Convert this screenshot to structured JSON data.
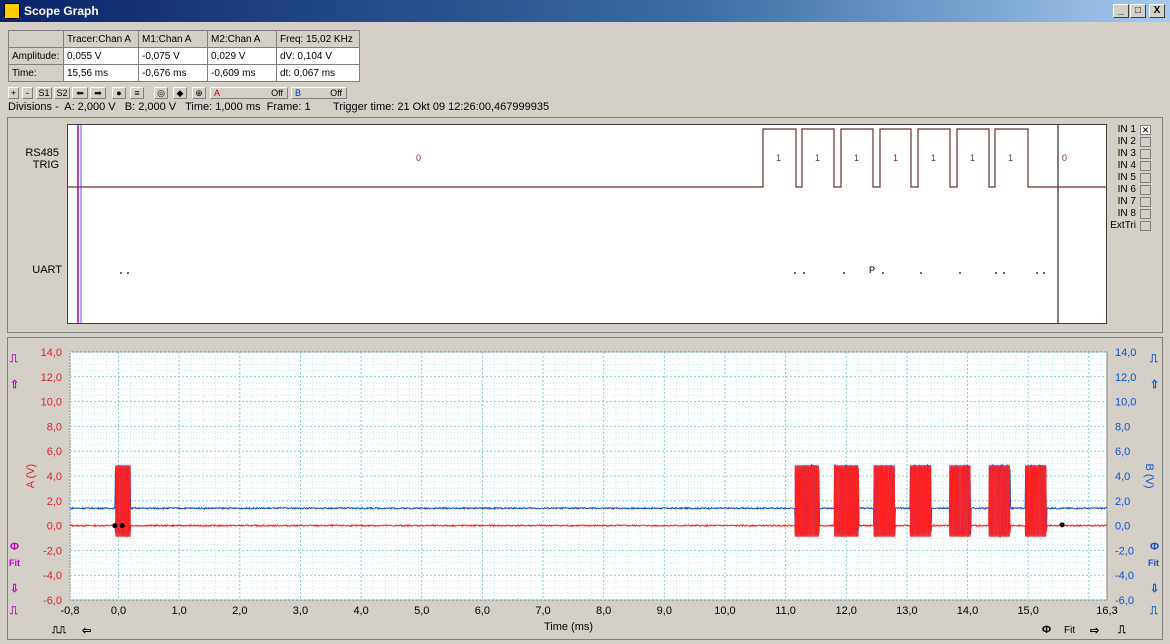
{
  "window": {
    "title": "Scope Graph",
    "buttons": [
      "_",
      "□",
      "X"
    ]
  },
  "measurements": {
    "headers": [
      "",
      "Tracer:Chan A",
      "M1:Chan A",
      "M2:Chan A",
      "Freq: 15,02 KHz"
    ],
    "rows": [
      [
        "Amplitude:",
        "0,055 V",
        "-0,075 V",
        "0,029 V",
        "dV: 0,104 V"
      ],
      [
        "Time:",
        "15,56 ms",
        "-0,676 ms",
        "-0,609 ms",
        "dt: 0,067 ms"
      ]
    ]
  },
  "toolbar": {
    "buttons": [
      "+",
      "-",
      "S1",
      "S2",
      "⬅",
      "➡",
      "●",
      "≡",
      "◎",
      "◆",
      "⊕"
    ],
    "chanA_label": "A",
    "chanA_state": "Off",
    "chanB_label": "B",
    "chanB_state": "Off"
  },
  "info": {
    "divisions": "Divisions -  A: 2,000 V   B: 2,000 V   Time: 1,000 ms  Frame: 1",
    "trigger": "Trigger time: 21 Okt 09 12:26:00,467999935"
  },
  "logic": {
    "rows": [
      {
        "label": "RS485"
      },
      {
        "label": "TRIG"
      },
      {
        "label": "UART"
      }
    ],
    "bits": [
      "0",
      "1",
      "1",
      "1",
      "1",
      "1",
      "1",
      "1",
      "0"
    ],
    "uart_char": "P",
    "inputs": [
      "IN 1",
      "IN 2",
      "IN 3",
      "IN 4",
      "IN 5",
      "IN 6",
      "IN 7",
      "IN 8",
      "ExtTri"
    ],
    "checked_input": "IN 1"
  },
  "chart_data": {
    "type": "line",
    "xlabel": "Time (ms)",
    "ylabel_left": "A (V)",
    "ylabel_right": "B (V)",
    "xlim": [
      -0.8,
      16.3
    ],
    "ylim": [
      -6,
      14
    ],
    "x_ticks": [
      "-0,8",
      "0,0",
      "1,0",
      "2,0",
      "3,0",
      "4,0",
      "5,0",
      "6,0",
      "7,0",
      "8,0",
      "9,0",
      "10,0",
      "11,0",
      "12,0",
      "13,0",
      "14,0",
      "15,0",
      "16,3"
    ],
    "y_ticks": [
      "14,0",
      "12,0",
      "10,0",
      "8,0",
      "6,0",
      "4,0",
      "2,0",
      "0,0",
      "-2,0",
      "-4,0",
      "-6,0"
    ],
    "grid": true,
    "series": [
      {
        "name": "A",
        "color": "#ff2020",
        "baseline": 0.0,
        "high": 4.8,
        "low": -0.9,
        "bursts": [
          [
            -0.05,
            0.2
          ],
          [
            11.15,
            11.55
          ],
          [
            11.8,
            12.2
          ],
          [
            12.45,
            12.8
          ],
          [
            13.05,
            13.4
          ],
          [
            13.7,
            14.05
          ],
          [
            14.35,
            14.7
          ],
          [
            14.95,
            15.3
          ]
        ]
      },
      {
        "name": "B",
        "color": "#1050d0",
        "baseline": 1.4,
        "high": 4.9,
        "low": -0.8,
        "bursts": [
          [
            -0.05,
            0.2
          ],
          [
            11.15,
            11.55
          ],
          [
            11.8,
            12.2
          ],
          [
            12.45,
            12.8
          ],
          [
            13.05,
            13.4
          ],
          [
            13.7,
            14.05
          ],
          [
            14.35,
            14.7
          ],
          [
            14.95,
            15.3
          ]
        ]
      }
    ],
    "markers": [
      {
        "x": -0.06,
        "y": 0.0
      },
      {
        "x": 0.06,
        "y": 0.0
      },
      {
        "x": 15.56,
        "y": 0.055
      }
    ]
  },
  "bottom": {
    "left_icons": [
      "trig-icon",
      "left-arrow-icon"
    ],
    "right_labels": [
      "Φ",
      "Fit",
      "⇨",
      "⎍"
    ]
  },
  "side": {
    "fit": "Fit"
  },
  "colors": {
    "titlebar": "#0a246a",
    "chanA": "#ff2020",
    "chanB": "#1050d0",
    "grid": "#a8dde0",
    "logic": "#6a3030"
  }
}
